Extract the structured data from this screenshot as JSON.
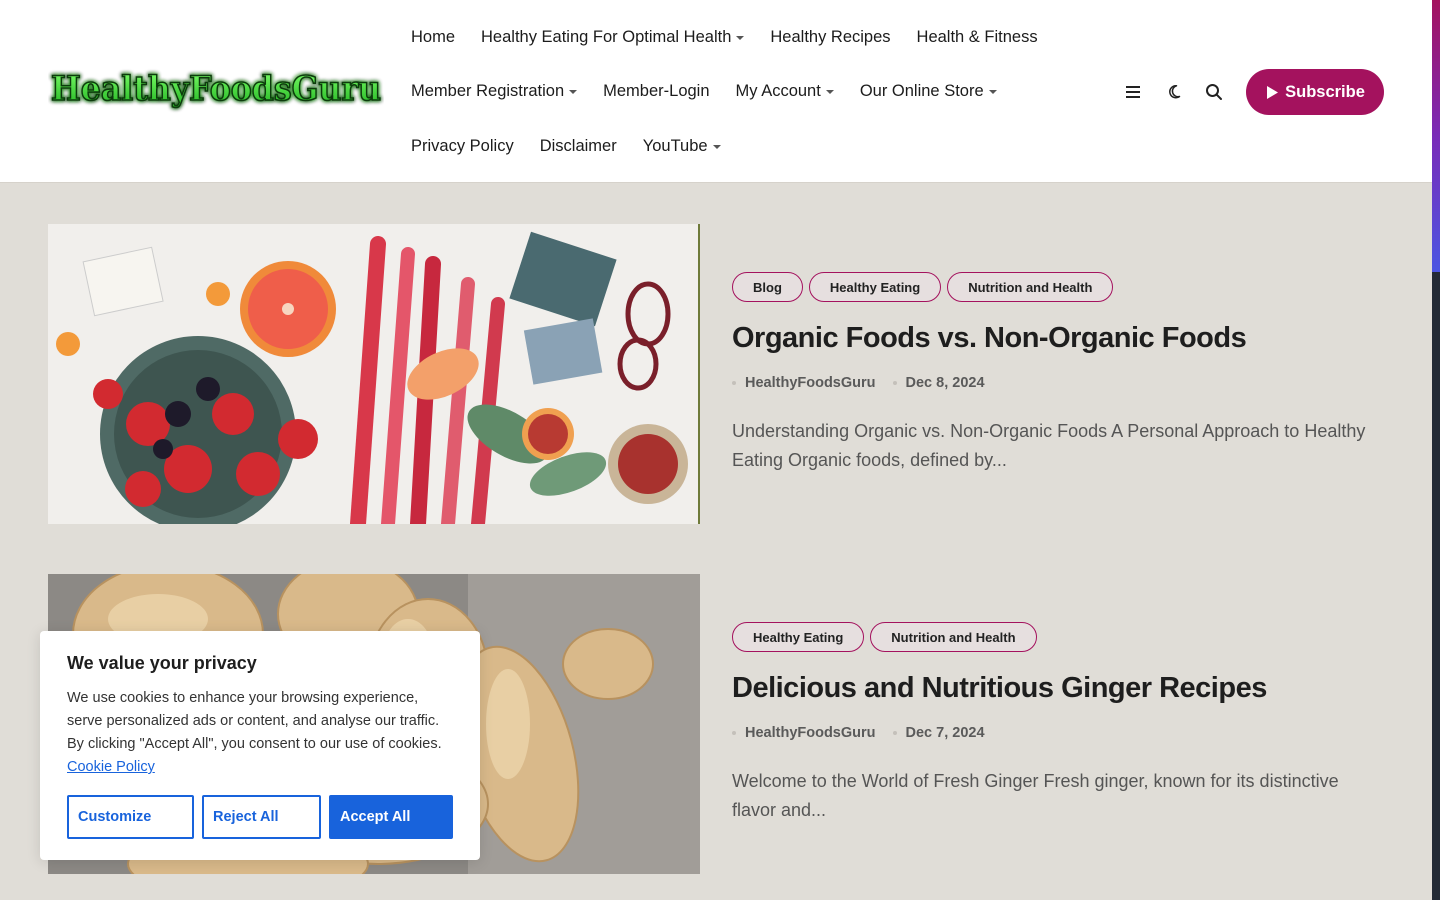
{
  "header": {
    "logo_text": "HealthyFoodsGuru",
    "nav_rows": [
      [
        {
          "label": "Home",
          "dropdown": false
        },
        {
          "label": "Healthy Eating For Optimal Health",
          "dropdown": true
        },
        {
          "label": "Healthy Recipes",
          "dropdown": false
        },
        {
          "label": "Health & Fitness",
          "dropdown": false
        }
      ],
      [
        {
          "label": "Member Registration",
          "dropdown": true
        },
        {
          "label": "Member-Login",
          "dropdown": false
        },
        {
          "label": "My Account",
          "dropdown": true
        },
        {
          "label": "Our Online Store",
          "dropdown": true
        }
      ],
      [
        {
          "label": "Privacy Policy",
          "dropdown": false
        },
        {
          "label": "Disclaimer",
          "dropdown": false
        },
        {
          "label": "YouTube",
          "dropdown": true
        }
      ]
    ],
    "tools": [
      "menu-icon",
      "moon-icon",
      "search-icon"
    ],
    "subscribe_label": "Subscribe"
  },
  "posts": [
    {
      "categories": [
        "Blog",
        "Healthy Eating",
        "Nutrition and Health"
      ],
      "title": "Organic Foods vs. Non-Organic Foods",
      "author": "HealthyFoodsGuru",
      "date": "Dec 8, 2024",
      "excerpt": "Understanding Organic vs. Non-Organic Foods A Personal Approach to Healthy Eating Organic foods, defined by..."
    },
    {
      "categories": [
        "Healthy Eating",
        "Nutrition and Health"
      ],
      "title": "Delicious and Nutritious Ginger Recipes",
      "author": "HealthyFoodsGuru",
      "date": "Dec 7, 2024",
      "excerpt": "Welcome to the World of Fresh Ginger Fresh ginger, known for its distinctive flavor and..."
    }
  ],
  "cookie": {
    "title": "We value your privacy",
    "text": "We use cookies to enhance your browsing experience, serve personalized ads or content, and analyse our traffic. By clicking \"Accept All\", you consent to our use of cookies.",
    "policy_link": "Cookie Policy",
    "buttons": {
      "customize": "Customize",
      "reject": "Reject All",
      "accept": "Accept All"
    }
  },
  "colors": {
    "accent": "#a4125e",
    "cookie_blue": "#1863dc",
    "page_bg": "#e0ddd7"
  }
}
